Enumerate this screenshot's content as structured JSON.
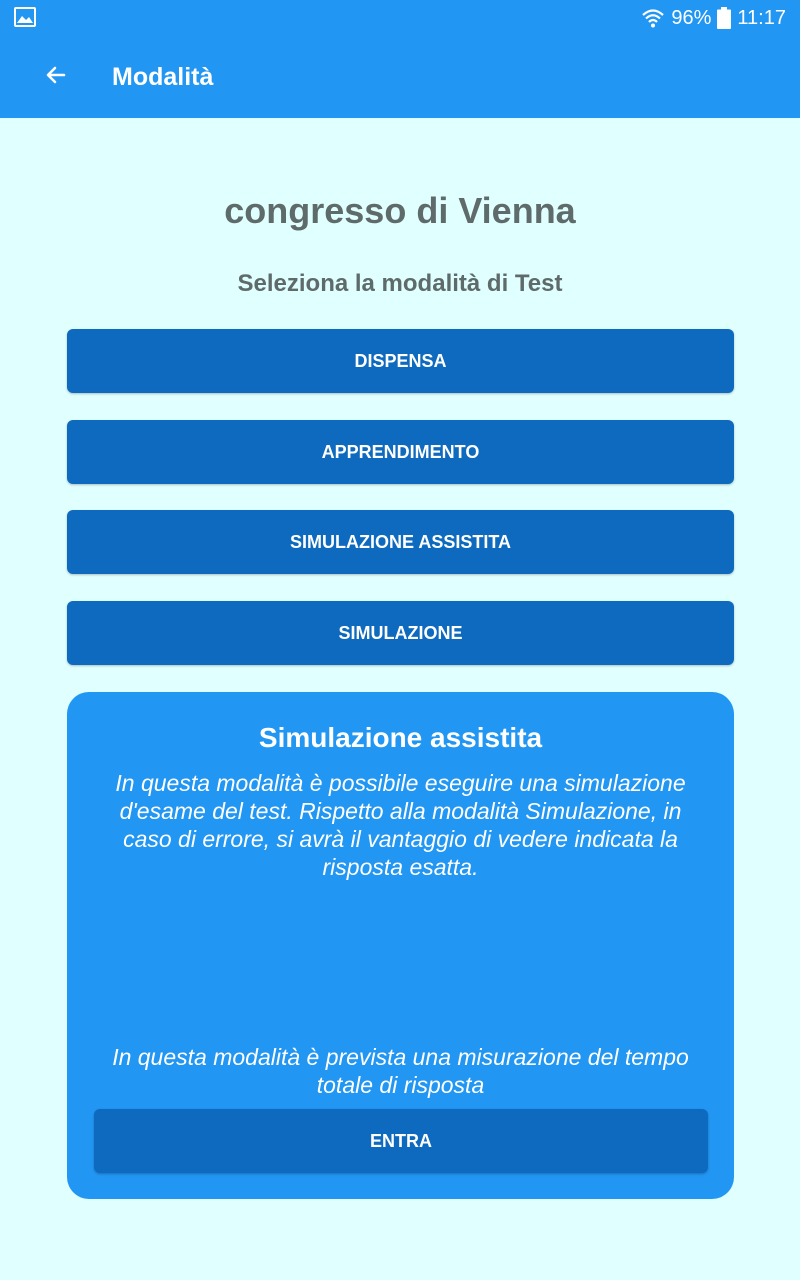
{
  "status_bar": {
    "left_icon": "image-icon",
    "wifi_icon": "wifi-icon",
    "battery_text": "96%",
    "battery_icon": "battery-icon",
    "time": "11:17"
  },
  "app_bar": {
    "back_icon": "arrow-back-icon",
    "title": "Modalità"
  },
  "main": {
    "title": "congresso di Vienna",
    "subtitle": "Seleziona la modalità di Test",
    "buttons": [
      {
        "label": "DISPENSA"
      },
      {
        "label": "APPRENDIMENTO"
      },
      {
        "label": "SIMULAZIONE ASSISTITA"
      },
      {
        "label": "SIMULAZIONE"
      }
    ]
  },
  "info_card": {
    "title": "Simulazione assistita",
    "description": "In questa modalità è possibile eseguire una simulazione d'esame del test. Rispetto alla modalità Simulazione, in caso di errore, si avrà il vantaggio di vedere indicata la risposta esatta.",
    "note": "In questa modalità è prevista una misurazione del tempo totale di risposta",
    "enter_label": "ENTRA"
  },
  "colors": {
    "primary": "#2196F3",
    "button": "#0D6ABF",
    "background": "#E0FFFF",
    "heading_text": "#5F6B6B"
  }
}
